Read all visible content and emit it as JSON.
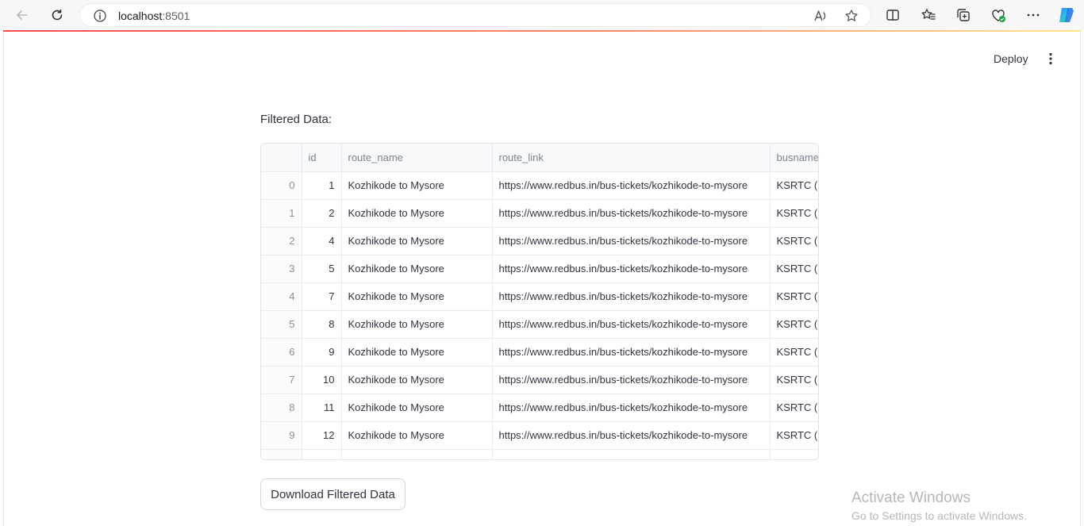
{
  "browser": {
    "url_host": "localhost",
    "url_port": ":8501"
  },
  "header": {
    "deploy_label": "Deploy"
  },
  "main": {
    "section_label": "Filtered Data:",
    "download_label": "Download Filtered Data"
  },
  "table": {
    "columns": [
      "",
      "id",
      "route_name",
      "route_link",
      "busname"
    ],
    "rows": [
      {
        "index": "0",
        "id": "1",
        "route_name": "Kozhikode to Mysore",
        "route_link": "https://www.redbus.in/bus-tickets/kozhikode-to-mysore",
        "busname": "KSRTC (K"
      },
      {
        "index": "1",
        "id": "2",
        "route_name": "Kozhikode to Mysore",
        "route_link": "https://www.redbus.in/bus-tickets/kozhikode-to-mysore",
        "busname": "KSRTC (K"
      },
      {
        "index": "2",
        "id": "4",
        "route_name": "Kozhikode to Mysore",
        "route_link": "https://www.redbus.in/bus-tickets/kozhikode-to-mysore",
        "busname": "KSRTC (K"
      },
      {
        "index": "3",
        "id": "5",
        "route_name": "Kozhikode to Mysore",
        "route_link": "https://www.redbus.in/bus-tickets/kozhikode-to-mysore",
        "busname": "KSRTC (K"
      },
      {
        "index": "4",
        "id": "7",
        "route_name": "Kozhikode to Mysore",
        "route_link": "https://www.redbus.in/bus-tickets/kozhikode-to-mysore",
        "busname": "KSRTC (K"
      },
      {
        "index": "5",
        "id": "8",
        "route_name": "Kozhikode to Mysore",
        "route_link": "https://www.redbus.in/bus-tickets/kozhikode-to-mysore",
        "busname": "KSRTC (K"
      },
      {
        "index": "6",
        "id": "9",
        "route_name": "Kozhikode to Mysore",
        "route_link": "https://www.redbus.in/bus-tickets/kozhikode-to-mysore",
        "busname": "KSRTC (K"
      },
      {
        "index": "7",
        "id": "10",
        "route_name": "Kozhikode to Mysore",
        "route_link": "https://www.redbus.in/bus-tickets/kozhikode-to-mysore",
        "busname": "KSRTC (K"
      },
      {
        "index": "8",
        "id": "11",
        "route_name": "Kozhikode to Mysore",
        "route_link": "https://www.redbus.in/bus-tickets/kozhikode-to-mysore",
        "busname": "KSRTC (K"
      },
      {
        "index": "9",
        "id": "12",
        "route_name": "Kozhikode to Mysore",
        "route_link": "https://www.redbus.in/bus-tickets/kozhikode-to-mysore",
        "busname": "KSRTC (K"
      }
    ]
  },
  "watermark": {
    "title": "Activate Windows",
    "subtitle": "Go to Settings to activate Windows."
  },
  "colors": {
    "accent_red": "#ff4b4b",
    "text": "#31333f",
    "header_bg": "#f8f9fb",
    "border": "#e3e4e8"
  },
  "icons": [
    "back-arrow-icon",
    "refresh-icon",
    "info-icon",
    "read-aloud-icon",
    "favorite-star-icon",
    "split-screen-icon",
    "favorites-icon",
    "collections-icon",
    "browser-essentials-icon",
    "more-dots-icon",
    "copilot-icon",
    "kebab-menu-icon"
  ]
}
